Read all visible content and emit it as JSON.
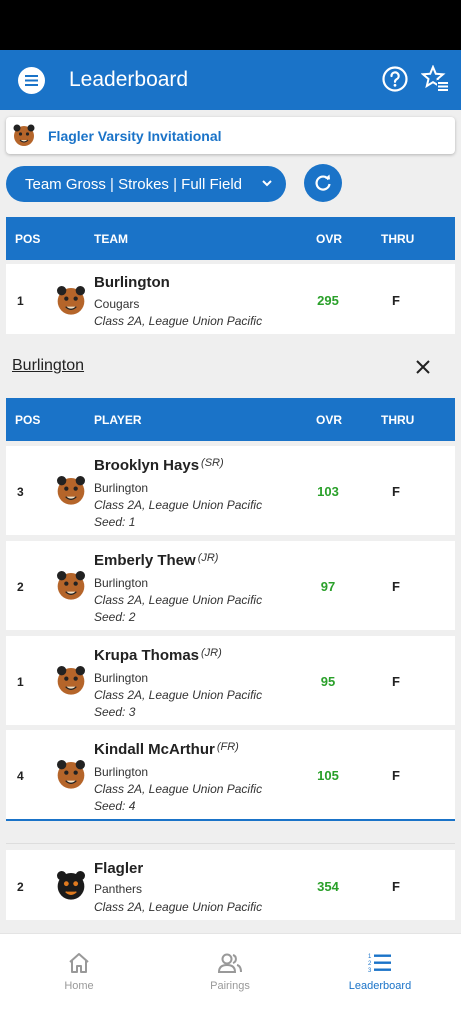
{
  "header": {
    "title": "Leaderboard"
  },
  "event": {
    "title": "Flagler Varsity Invitational"
  },
  "filter": {
    "label": "Team Gross | Strokes | Full Field"
  },
  "colors": {
    "primary": "#1a73c8",
    "score": "#2aa02a"
  },
  "team_table": {
    "headers": {
      "pos": "POS",
      "team": "TEAM",
      "ovr": "OVR",
      "thru": "THRU"
    },
    "rows": [
      {
        "pos": "1",
        "name": "Burlington",
        "mascot": "Cougars",
        "league": "Class 2A, League Union Pacific",
        "ovr": "295",
        "thru": "F",
        "icon": "cougar-logo-icon"
      }
    ]
  },
  "player_section": {
    "title": "Burlington"
  },
  "player_table": {
    "headers": {
      "pos": "POS",
      "player": "PLAYER",
      "ovr": "OVR",
      "thru": "THRU"
    },
    "rows": [
      {
        "pos": "3",
        "name": "Brooklyn Hays",
        "class": "(SR)",
        "school": "Burlington",
        "league": "Class 2A, League Union Pacific",
        "seed": "Seed: 1",
        "ovr": "103",
        "thru": "F"
      },
      {
        "pos": "2",
        "name": "Emberly Thew",
        "class": "(JR)",
        "school": "Burlington",
        "league": "Class 2A, League Union Pacific",
        "seed": "Seed: 2",
        "ovr": "97",
        "thru": "F"
      },
      {
        "pos": "1",
        "name": "Krupa Thomas",
        "class": "(JR)",
        "school": "Burlington",
        "league": "Class 2A, League Union Pacific",
        "seed": "Seed: 3",
        "ovr": "95",
        "thru": "F"
      },
      {
        "pos": "4",
        "name": "Kindall McArthur",
        "class": "(FR)",
        "school": "Burlington",
        "league": "Class 2A, League Union Pacific",
        "seed": "Seed: 4",
        "ovr": "105",
        "thru": "F"
      }
    ]
  },
  "team_row_2": {
    "pos": "2",
    "name": "Flagler",
    "mascot": "Panthers",
    "league": "Class 2A, League Union Pacific",
    "ovr": "354",
    "thru": "F",
    "icon": "panther-logo-icon"
  },
  "nav": {
    "home": "Home",
    "pairings": "Pairings",
    "leaderboard": "Leaderboard"
  }
}
